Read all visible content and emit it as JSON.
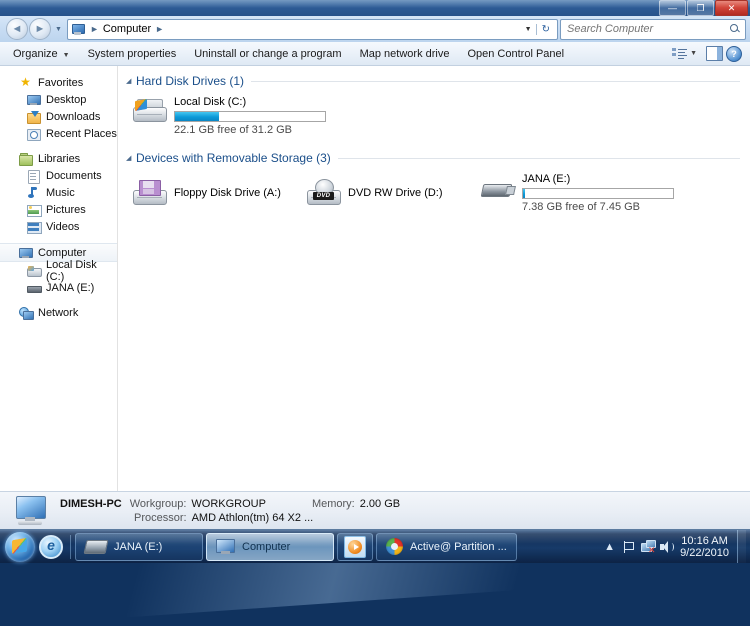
{
  "window": {
    "title": "Computer",
    "controls": {
      "minimize": "—",
      "maximize": "❐",
      "close": "✕"
    }
  },
  "address_bar": {
    "back_icon": "◄",
    "forward_icon": "►",
    "history_caret": "▼",
    "crumb_root": "Computer",
    "sep": "►",
    "dropdown_caret": "▼",
    "refresh_icon": "↻"
  },
  "search": {
    "placeholder": "Search Computer",
    "value": ""
  },
  "toolbar": {
    "organize": "Organize",
    "organize_caret": "▼",
    "system_properties": "System properties",
    "uninstall": "Uninstall or change a program",
    "map_network_drive": "Map network drive",
    "open_control_panel": "Open Control Panel",
    "views_caret": "▼",
    "help_glyph": "?"
  },
  "sidebar": {
    "groups": [
      {
        "header": "Favorites",
        "items": [
          {
            "label": "Desktop"
          },
          {
            "label": "Downloads"
          },
          {
            "label": "Recent Places"
          }
        ]
      },
      {
        "header": "Libraries",
        "items": [
          {
            "label": "Documents"
          },
          {
            "label": "Music"
          },
          {
            "label": "Pictures"
          },
          {
            "label": "Videos"
          }
        ]
      },
      {
        "header": "Computer",
        "items": [
          {
            "label": "Local Disk (C:)"
          },
          {
            "label": "JANA (E:)"
          }
        ]
      },
      {
        "header": "Network",
        "items": []
      }
    ]
  },
  "content": {
    "sections": [
      {
        "title": "Hard Disk Drives (1)",
        "collapse_icon": "◢",
        "drives": [
          {
            "name": "Local Disk (C:)",
            "free_text": "22.1 GB free of 31.2 GB",
            "used_percent": 29,
            "bar_color": "#0d9ad8",
            "has_bar": true
          }
        ]
      },
      {
        "title": "Devices with Removable Storage (3)",
        "collapse_icon": "◢",
        "drives": [
          {
            "name": "Floppy Disk Drive (A:)",
            "has_bar": false
          },
          {
            "name": "DVD RW Drive (D:)",
            "has_bar": false
          },
          {
            "name": "JANA (E:)",
            "free_text": "7.38 GB free of 7.45 GB",
            "used_percent": 1,
            "bar_color": "#0d9ad8",
            "has_bar": true
          }
        ]
      }
    ]
  },
  "details_pane": {
    "computer_name": "DIMESH-PC",
    "workgroup_label": "Workgroup:",
    "workgroup_value": "WORKGROUP",
    "memory_label": "Memory:",
    "memory_value": "2.00 GB",
    "processor_label": "Processor:",
    "processor_value": "AMD Athlon(tm) 64 X2 ..."
  },
  "taskbar": {
    "start_tooltip": "Start",
    "quick_launch": [
      {
        "name": "Internet Explorer"
      }
    ],
    "buttons": [
      {
        "label": "JANA (E:)",
        "active": false,
        "icon": "usb-drive-icon"
      },
      {
        "label": "Computer",
        "active": true,
        "icon": "computer-icon"
      },
      {
        "label": "",
        "active": false,
        "icon": "media-player-icon"
      },
      {
        "label": "Active@ Partition ...",
        "active": false,
        "icon": "partition-manager-icon"
      }
    ],
    "tray": {
      "chevron": "▲",
      "action_center": "flag-icon",
      "network": "network-icon",
      "volume": "speaker-icon",
      "time": "10:16 AM",
      "date": "9/22/2010"
    }
  }
}
